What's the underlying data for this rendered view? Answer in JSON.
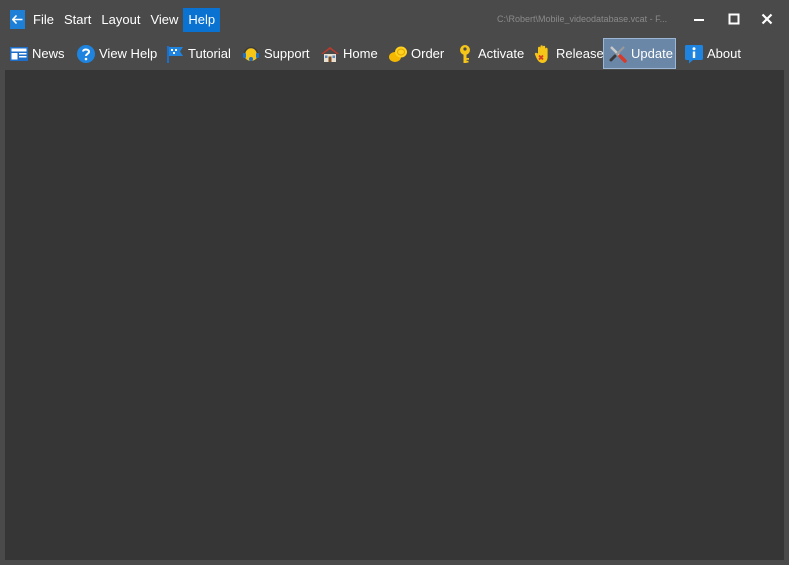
{
  "window": {
    "path_title": "C:\\Robert\\Mobile_videodatabase.vcat - F..."
  },
  "menu": {
    "items": [
      {
        "label": "File"
      },
      {
        "label": "Start"
      },
      {
        "label": "Layout"
      },
      {
        "label": "View"
      },
      {
        "label": "Help",
        "active": true
      }
    ]
  },
  "ribbon": {
    "buttons": [
      {
        "label": "News",
        "icon": "news-icon"
      },
      {
        "label": "View Help",
        "icon": "help-icon"
      },
      {
        "label": "Tutorial",
        "icon": "flag-icon"
      },
      {
        "label": "Support",
        "icon": "headset-icon"
      },
      {
        "label": "Home",
        "icon": "house-icon"
      },
      {
        "label": "Order",
        "icon": "coins-icon"
      },
      {
        "label": "Activate",
        "icon": "key-icon"
      },
      {
        "label": "Release",
        "icon": "hand-icon"
      },
      {
        "label": "Update",
        "icon": "tools-icon",
        "selected": true
      },
      {
        "label": "About",
        "icon": "info-icon"
      }
    ]
  },
  "colors": {
    "accent": "#0a73d1",
    "window_bg": "#4a4a4a",
    "content_bg": "#363636",
    "selected_bg": "#6b87a8"
  }
}
